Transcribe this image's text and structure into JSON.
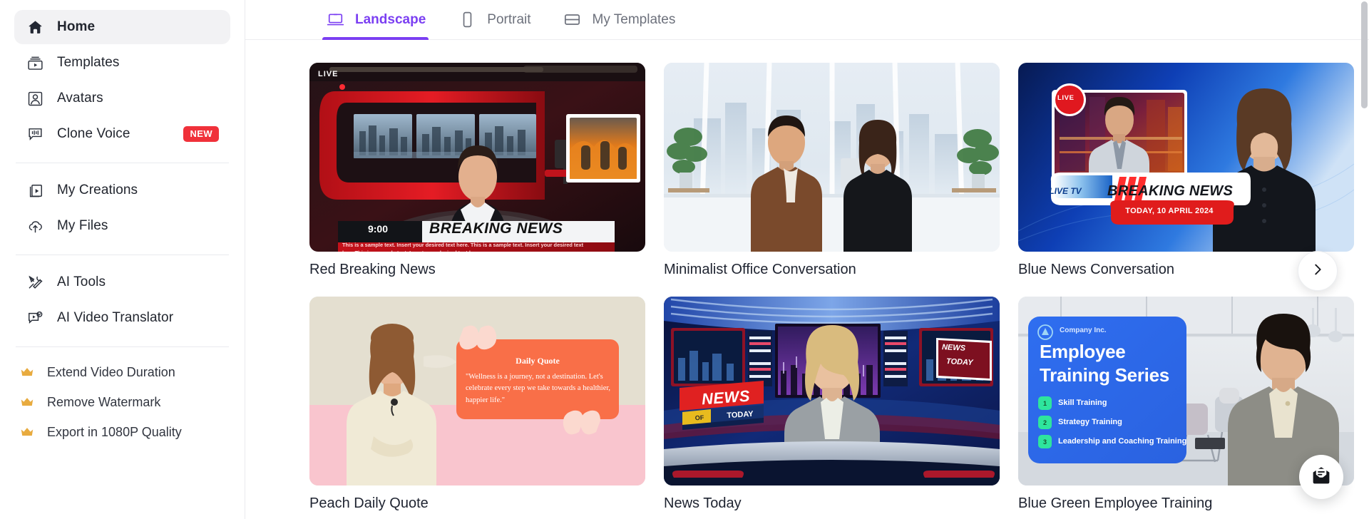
{
  "sidebar": {
    "primary_items": [
      {
        "label": "Home",
        "icon": "home-icon",
        "active": true
      },
      {
        "label": "Templates",
        "icon": "templates-icon",
        "active": false
      },
      {
        "label": "Avatars",
        "icon": "avatar-icon",
        "active": false
      },
      {
        "label": "Clone Voice",
        "icon": "voice-waveform-icon",
        "badge": "NEW",
        "active": false
      }
    ],
    "secondary_items": [
      {
        "label": "My Creations",
        "icon": "creations-icon"
      },
      {
        "label": "My Files",
        "icon": "cloud-upload-icon"
      }
    ],
    "tools_items": [
      {
        "label": "AI Tools",
        "icon": "tools-icon"
      },
      {
        "label": "AI Video Translator",
        "icon": "translate-video-icon"
      }
    ],
    "pro_items": [
      {
        "label": "Extend Video Duration",
        "icon": "crown-icon"
      },
      {
        "label": "Remove Watermark",
        "icon": "crown-icon"
      },
      {
        "label": "Export in 1080P Quality",
        "icon": "crown-icon"
      }
    ]
  },
  "tabs": [
    {
      "label": "Landscape",
      "icon": "laptop-icon",
      "active": true
    },
    {
      "label": "Portrait",
      "icon": "phone-icon",
      "active": false
    },
    {
      "label": "My Templates",
      "icon": "card-icon",
      "active": false
    }
  ],
  "cards": [
    {
      "title": "Red Breaking News",
      "art": "red-breaking-news",
      "overlay": {
        "live_label": "LIVE",
        "time": "9:00",
        "headline": "BREAKING NEWS",
        "ticker": "This is a sample text. Insert your desired text here. This is a sample text. Insert your desired text here.This is a sample text. Insert your desired text here."
      }
    },
    {
      "title": "Minimalist Office Conversation",
      "art": "minimalist-office",
      "overlay": {}
    },
    {
      "title": "Blue News Conversation",
      "art": "blue-news",
      "overlay": {
        "live_badge": "LIVE",
        "live_tv": "LIVE TV",
        "headline": "BREAKING NEWS",
        "date": "TODAY, 10 APRIL 2024"
      }
    },
    {
      "title": "Peach Daily Quote",
      "art": "peach-daily-quote",
      "overlay": {
        "quote_title": "Daily Quote",
        "quote_body": "\"Wellness is a journey, not a  destination. Let's celebrate every step we take towards a healthier, happier life.\""
      }
    },
    {
      "title": "News Today",
      "art": "news-today",
      "overlay": {
        "news": "NEWS",
        "of": "OF",
        "today": "TODAY",
        "corner_line1": "NEWS",
        "corner_line2": "TODAY"
      }
    },
    {
      "title": "Blue Green Employee Training",
      "art": "employee-training",
      "overlay": {
        "company": "Company Inc.",
        "title_line1": "Employee",
        "title_line2": "Training Series",
        "bullets": [
          {
            "num": "1",
            "text": "Skill Training"
          },
          {
            "num": "2",
            "text": "Strategy Training"
          },
          {
            "num": "3",
            "text": "Leadership and Coaching Training"
          }
        ]
      }
    }
  ],
  "controls": {
    "next_arrow": "chevron-right-icon",
    "chat_fab": "message-envelope-icon"
  },
  "colors": {
    "accent": "#7b3ff2",
    "badge_new": "#f0313a",
    "crown": "#e8ab3f",
    "text": "#1e2330",
    "muted": "#6d717c"
  }
}
